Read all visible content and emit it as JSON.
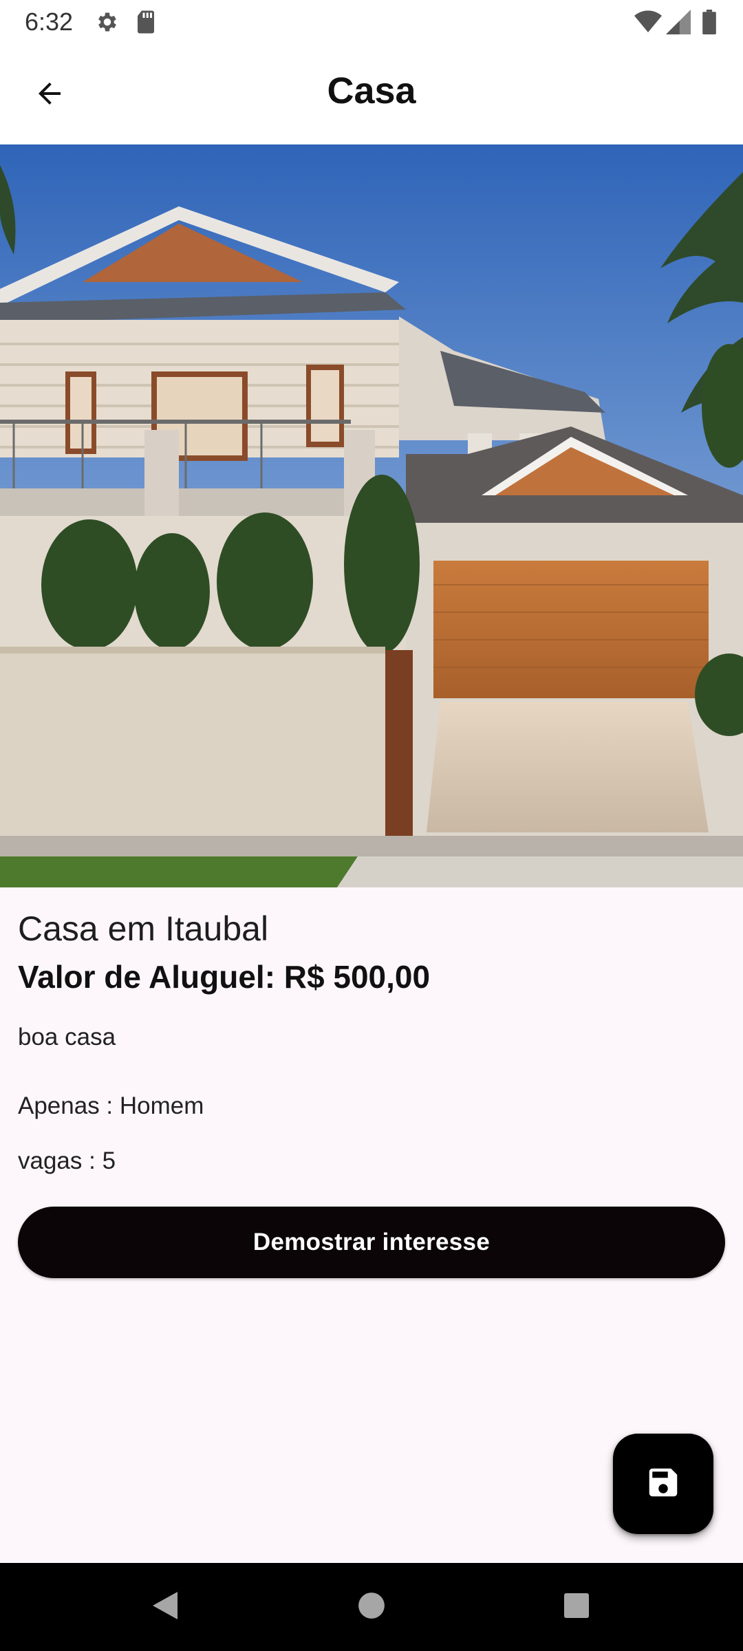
{
  "status_bar": {
    "time": "6:32",
    "icons": [
      "gear-icon",
      "sd-card-icon",
      "wifi-icon",
      "signal-icon",
      "battery-icon"
    ]
  },
  "app_bar": {
    "title": "Casa",
    "back_icon": "arrow-back-icon"
  },
  "listing": {
    "title": "Casa em Itaubal",
    "price": "Valor de Aluguel: R$ 500,00",
    "description": "boa casa",
    "gender": "Apenas : Homem",
    "slots": "vagas : 5"
  },
  "actions": {
    "interest_label": "Demostrar interesse",
    "fab_icon": "save-icon"
  },
  "nav_bar": {
    "icons": [
      "back-triangle-icon",
      "home-circle-icon",
      "recents-square-icon"
    ]
  },
  "colors": {
    "background": "#fdf7fb",
    "primary_button": "#0b0507",
    "fab": "#000000",
    "nav_bar": "#000000"
  }
}
